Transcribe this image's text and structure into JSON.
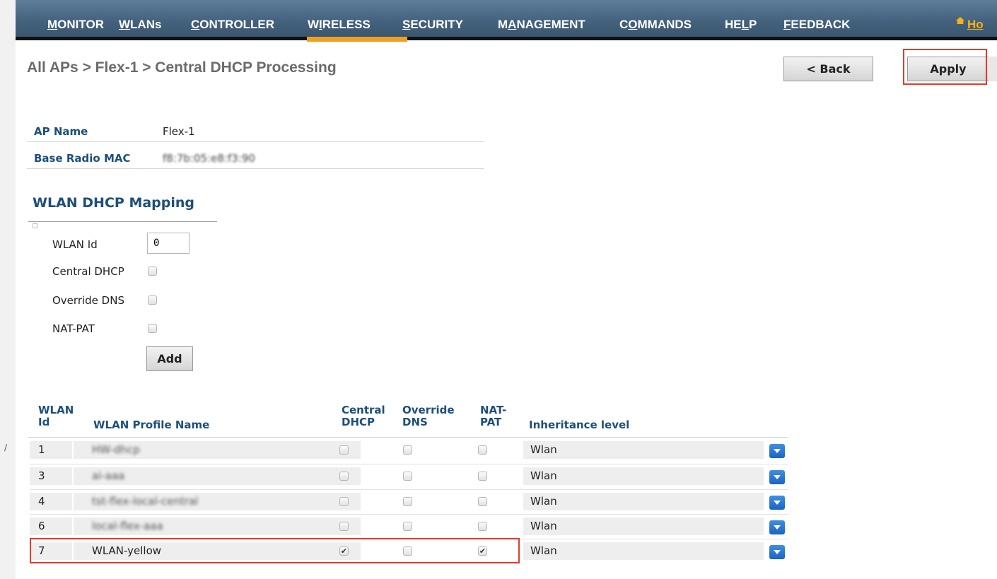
{
  "nav": {
    "items": [
      {
        "pre": "",
        "u": "M",
        "post": "ONITOR"
      },
      {
        "pre": "",
        "u": "W",
        "post": "LANs"
      },
      {
        "pre": "",
        "u": "C",
        "post": "ONTROLLER"
      },
      {
        "pre": "W",
        "u": "I",
        "post": "RELESS"
      },
      {
        "pre": "",
        "u": "S",
        "post": "ECURITY"
      },
      {
        "pre": "M",
        "u": "A",
        "post": "NAGEMENT"
      },
      {
        "pre": "C",
        "u": "O",
        "post": "MMANDS"
      },
      {
        "pre": "HE",
        "u": "L",
        "post": "P"
      },
      {
        "pre": "",
        "u": "F",
        "post": "EEDBACK"
      }
    ],
    "active": "WIRELESS",
    "home_label": "Ho",
    "home_icon": "home-icon"
  },
  "page": {
    "title": "All APs > Flex-1 > Central DHCP Processing",
    "back_label": "< Back",
    "apply_label": "Apply"
  },
  "ap_info": {
    "name_label": "AP Name",
    "name_value": "Flex-1",
    "mac_label": "Base Radio MAC",
    "mac_value": "f8:7b:05:e8:f3:90"
  },
  "mapping": {
    "title": "WLAN DHCP Mapping",
    "wlan_id_label": "WLAN Id",
    "wlan_id_value": "0",
    "central_dhcp_label": "Central DHCP",
    "override_dns_label": "Override DNS",
    "nat_pat_label": "NAT-PAT",
    "add_label": "Add"
  },
  "table": {
    "headers": {
      "wlan_id_1": "WLAN",
      "wlan_id_2": "Id",
      "profile": "WLAN Profile Name",
      "central_1": "Central",
      "central_2": "DHCP",
      "override_1": "Override",
      "override_2": "DNS",
      "nat_1": "NAT-",
      "nat_2": "PAT",
      "inheritance": "Inheritance level"
    },
    "rows": [
      {
        "id": "1",
        "name": "HW-dhcp",
        "central_dhcp": false,
        "override_dns": false,
        "nat_pat": false,
        "inheritance": "Wlan",
        "obscured": true
      },
      {
        "id": "3",
        "name": "ai-aaa",
        "central_dhcp": false,
        "override_dns": false,
        "nat_pat": false,
        "inheritance": "Wlan",
        "obscured": true
      },
      {
        "id": "4",
        "name": "tst-flex-local-central",
        "central_dhcp": false,
        "override_dns": false,
        "nat_pat": false,
        "inheritance": "Wlan",
        "obscured": true
      },
      {
        "id": "6",
        "name": "local-flex-aaa",
        "central_dhcp": false,
        "override_dns": false,
        "nat_pat": false,
        "inheritance": "Wlan",
        "obscured": true
      },
      {
        "id": "7",
        "name": "WLAN-yellow",
        "central_dhcp": true,
        "override_dns": false,
        "nat_pat": true,
        "inheritance": "Wlan",
        "obscured": false
      }
    ]
  },
  "colors": {
    "nav_bg": "#45637e",
    "active_tab": "#f0a020",
    "header_text": "#1d4f7a",
    "highlight": "#e23b2a",
    "dropdown": "#1a64c4"
  }
}
